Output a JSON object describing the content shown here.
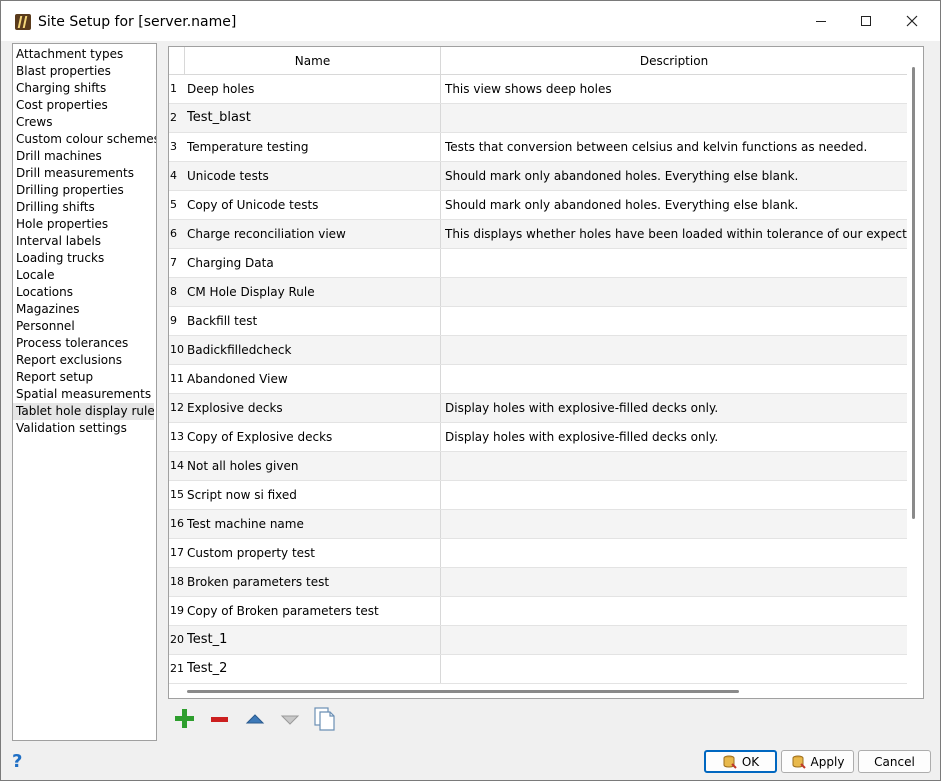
{
  "window": {
    "title": "Site Setup for [server.name]"
  },
  "sidebar": {
    "items": [
      {
        "label": "Attachment types"
      },
      {
        "label": "Blast properties"
      },
      {
        "label": "Charging shifts"
      },
      {
        "label": "Cost properties"
      },
      {
        "label": "Crews"
      },
      {
        "label": "Custom colour schemes"
      },
      {
        "label": "Drill machines"
      },
      {
        "label": "Drill measurements"
      },
      {
        "label": "Drilling properties"
      },
      {
        "label": "Drilling shifts"
      },
      {
        "label": "Hole properties"
      },
      {
        "label": "Interval labels"
      },
      {
        "label": "Loading trucks"
      },
      {
        "label": "Locale"
      },
      {
        "label": "Locations"
      },
      {
        "label": "Magazines"
      },
      {
        "label": "Personnel"
      },
      {
        "label": "Process tolerances"
      },
      {
        "label": "Report exclusions"
      },
      {
        "label": "Report setup"
      },
      {
        "label": "Spatial measurements"
      },
      {
        "label": "Tablet hole display rules"
      },
      {
        "label": "Validation settings"
      }
    ],
    "selected": "Tablet hole display rules"
  },
  "table": {
    "columns": {
      "name": "Name",
      "description": "Description"
    },
    "rows": [
      {
        "num": "1",
        "name": "Deep holes",
        "description": "This view shows deep holes"
      },
      {
        "num": "2",
        "name": "Test_blast",
        "description": ""
      },
      {
        "num": "3",
        "name": "Temperature testing",
        "description": "Tests that conversion between celsius and kelvin functions as needed."
      },
      {
        "num": "4",
        "name": "Unicode tests",
        "description": "Should mark only abandoned holes. Everything else blank."
      },
      {
        "num": "5",
        "name": "Copy of Unicode tests",
        "description": "Should mark only abandoned holes. Everything else blank."
      },
      {
        "num": "6",
        "name": "Charge reconciliation view",
        "description": "This displays whether holes have been loaded within tolerance of our expected charge n"
      },
      {
        "num": "7",
        "name": "Charging Data",
        "description": ""
      },
      {
        "num": "8",
        "name": "CM Hole Display Rule",
        "description": ""
      },
      {
        "num": "9",
        "name": "Backfill test",
        "description": ""
      },
      {
        "num": "10",
        "name": "Badickfilledcheck",
        "description": ""
      },
      {
        "num": "11",
        "name": "Abandoned View",
        "description": ""
      },
      {
        "num": "12",
        "name": "Explosive decks",
        "description": "Display holes with explosive-filled decks only."
      },
      {
        "num": "13",
        "name": "Copy of Explosive decks",
        "description": "Display holes with explosive-filled decks only."
      },
      {
        "num": "14",
        "name": "Not all holes given",
        "description": ""
      },
      {
        "num": "15",
        "name": "Script now si fixed",
        "description": ""
      },
      {
        "num": "16",
        "name": "Test machine name",
        "description": ""
      },
      {
        "num": "17",
        "name": "Custom property test",
        "description": ""
      },
      {
        "num": "18",
        "name": "Broken parameters test",
        "description": ""
      },
      {
        "num": "19",
        "name": "Copy of Broken parameters test",
        "description": ""
      },
      {
        "num": "20",
        "name": "Test_1",
        "description": ""
      },
      {
        "num": "21",
        "name": "Test_2",
        "description": ""
      }
    ]
  },
  "toolbar": {
    "icons": [
      "add-icon",
      "remove-icon",
      "move-up-icon",
      "move-down-icon",
      "copy-icon"
    ]
  },
  "buttons": {
    "help": "?",
    "ok": "OK",
    "apply": "Apply",
    "cancel": "Cancel"
  },
  "colors": {
    "add": "#2e9e2e",
    "remove": "#cc1f1f",
    "accent": "#0067c0"
  }
}
